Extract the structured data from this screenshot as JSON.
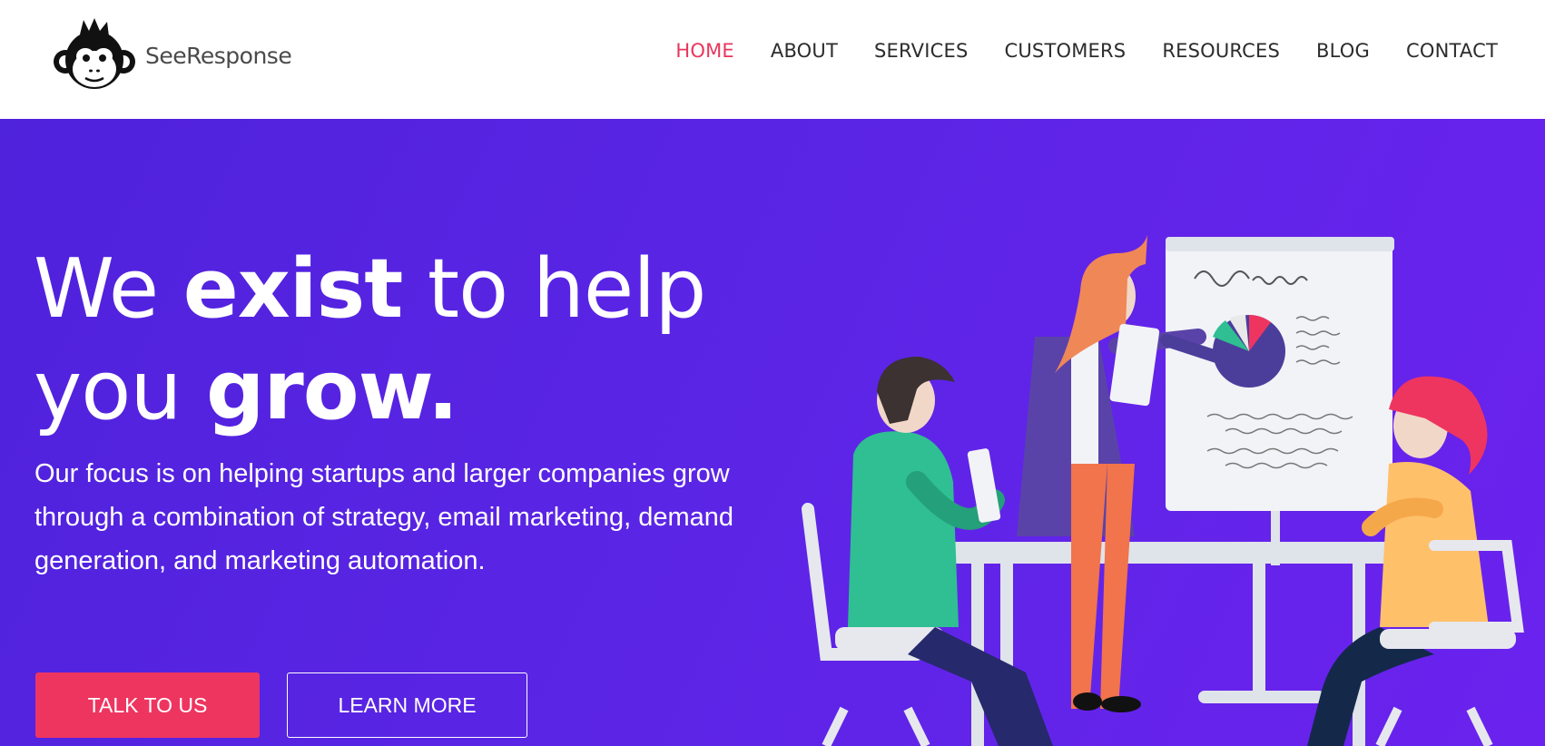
{
  "brand": {
    "name": "SeeResponse",
    "accent": "#e8365d",
    "hero_bg": "#5a24e4"
  },
  "nav": {
    "items": [
      {
        "label": "HOME",
        "active": true
      },
      {
        "label": "ABOUT",
        "active": false
      },
      {
        "label": "SERVICES",
        "active": false
      },
      {
        "label": "CUSTOMERS",
        "active": false
      },
      {
        "label": "RESOURCES",
        "active": false
      },
      {
        "label": "BLOG",
        "active": false
      },
      {
        "label": "CONTACT",
        "active": false
      }
    ]
  },
  "hero": {
    "headline": {
      "part1": "We ",
      "bold1": "exist",
      "part2": " to help",
      "part3": "you ",
      "bold2": "grow."
    },
    "subtext": "Our focus is on helping startups and larger companies grow through a combination of strategy, email marketing, demand generation, and marketing automation.",
    "primary_button": "TALK TO US",
    "secondary_button": "LEARN MORE"
  }
}
